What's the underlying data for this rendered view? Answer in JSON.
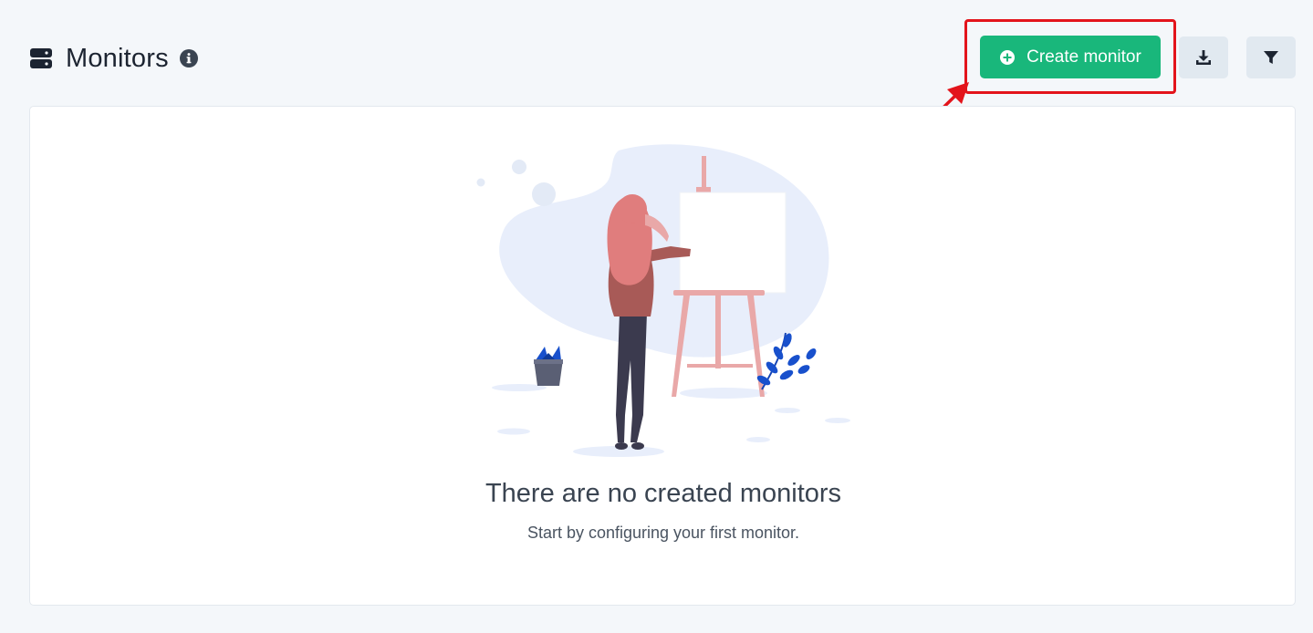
{
  "header": {
    "title": "Monitors",
    "title_icon": "server-icon",
    "info_icon": "info-icon"
  },
  "toolbar": {
    "create_label": "Create monitor",
    "create_icon": "plus-circle-icon",
    "download_icon": "download-icon",
    "filter_icon": "filter-icon"
  },
  "empty_state": {
    "title": "There are no created monitors",
    "subtitle": "Start by configuring your first monitor."
  },
  "colors": {
    "accent": "#19b77b",
    "highlight": "#e3141b",
    "secondary_button": "#e1e9f0",
    "background": "#f4f7fa"
  }
}
